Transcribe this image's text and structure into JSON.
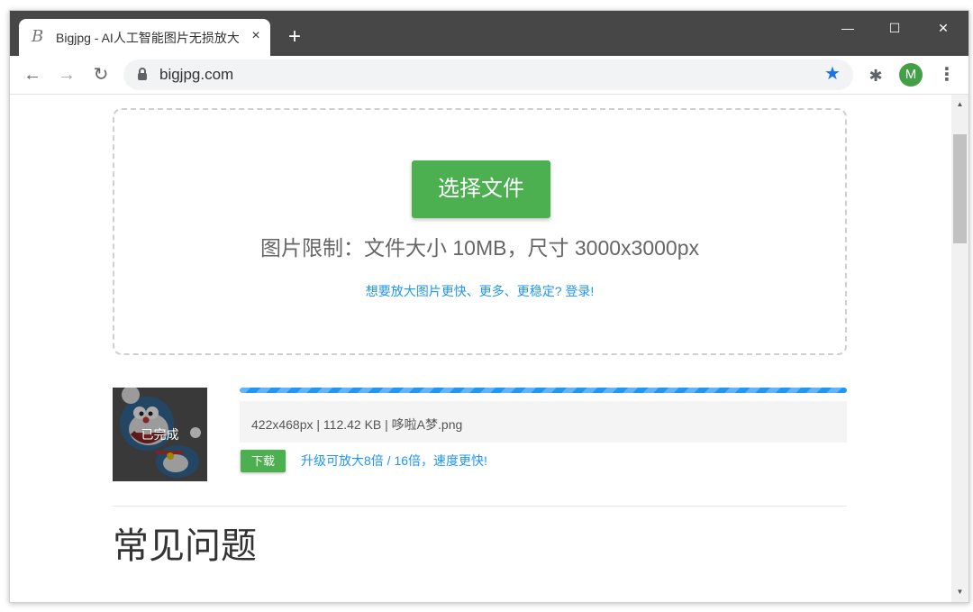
{
  "browser": {
    "tab_title": "Bigjpg - AI人工智能图片无损放大",
    "tab_favicon_letter": "B",
    "url": "bigjpg.com",
    "avatar_letter": "M",
    "accent_color": "#1a73e8"
  },
  "icons": {
    "tab_close": "×",
    "new_tab": "+",
    "minimize": "—",
    "maximize": "☐",
    "close": "✕",
    "back": "←",
    "forward": "→",
    "reload": "↻",
    "bookmark_star": "★",
    "extensions": "✱",
    "menu": "⋮",
    "scroll_up": "▲",
    "scroll_down": "▼"
  },
  "upload": {
    "choose_button": "选择文件",
    "limit_text": "图片限制：文件大小 10MB，尺寸 3000x3000px",
    "login_link": "想要放大图片更快、更多、更稳定? 登录!"
  },
  "job": {
    "status": "已完成",
    "progress": 1.0,
    "file_info": "422x468px | 112.42 KB | 哆啦A梦.png",
    "download_button": "下载",
    "upgrade_text": "升级可放大8倍 / 16倍，速度更快!"
  },
  "faq": {
    "title": "常见问题"
  },
  "colors": {
    "primary_green": "#4caf50",
    "link_blue": "#2196f3",
    "titlebar": "#474747"
  }
}
